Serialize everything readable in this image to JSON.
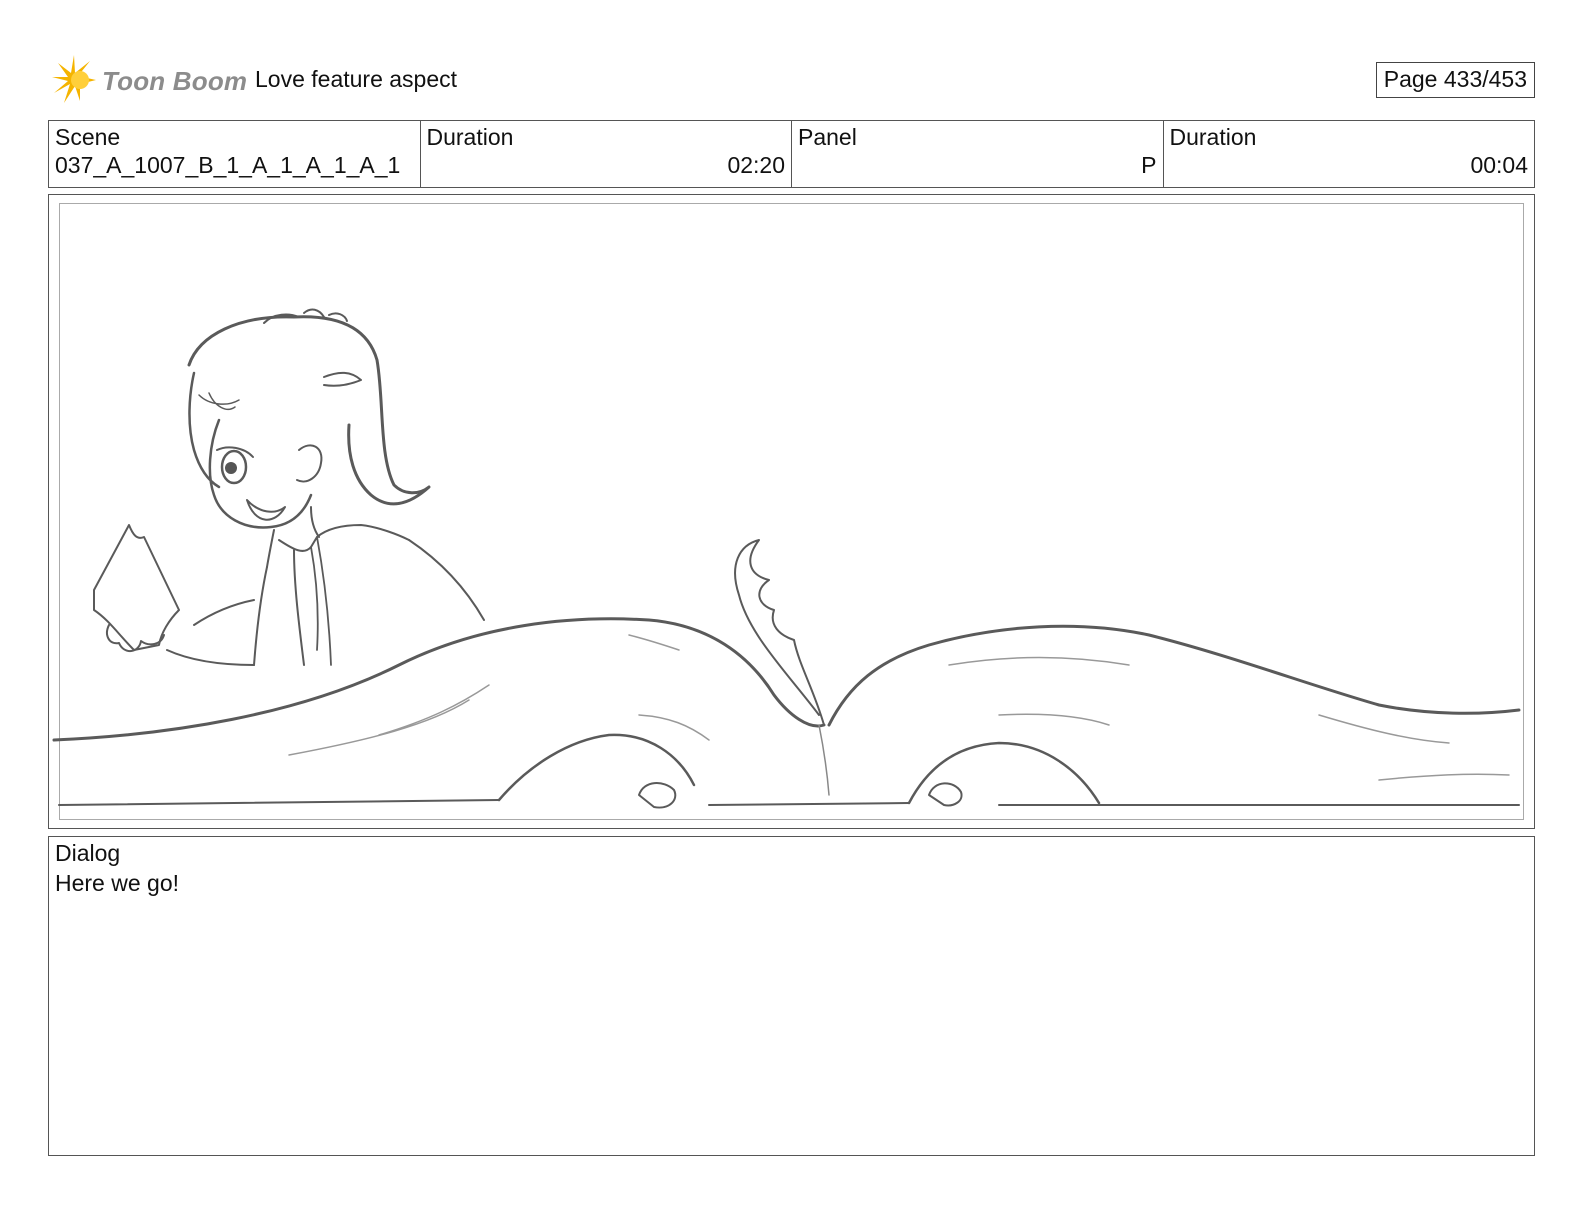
{
  "header": {
    "logo_text": "Toon Boom",
    "project_title": "Love feature aspect",
    "page_label": "Page 433/453"
  },
  "info": {
    "scene_label": "Scene",
    "scene_value": "037_A_1007_B_1_A_1_A_1_A_1",
    "scene_duration_label": "Duration",
    "scene_duration_value": "02:20",
    "panel_label": "Panel",
    "panel_value": "P",
    "panel_duration_label": "Duration",
    "panel_duration_value": "00:04"
  },
  "dialog": {
    "label": "Dialog",
    "text": "Here we go!"
  },
  "colors": {
    "logo_gold": "#f5b400",
    "logo_text": "#8c8c8c",
    "border": "#555555",
    "sketch_stroke": "#5a5a5a"
  }
}
